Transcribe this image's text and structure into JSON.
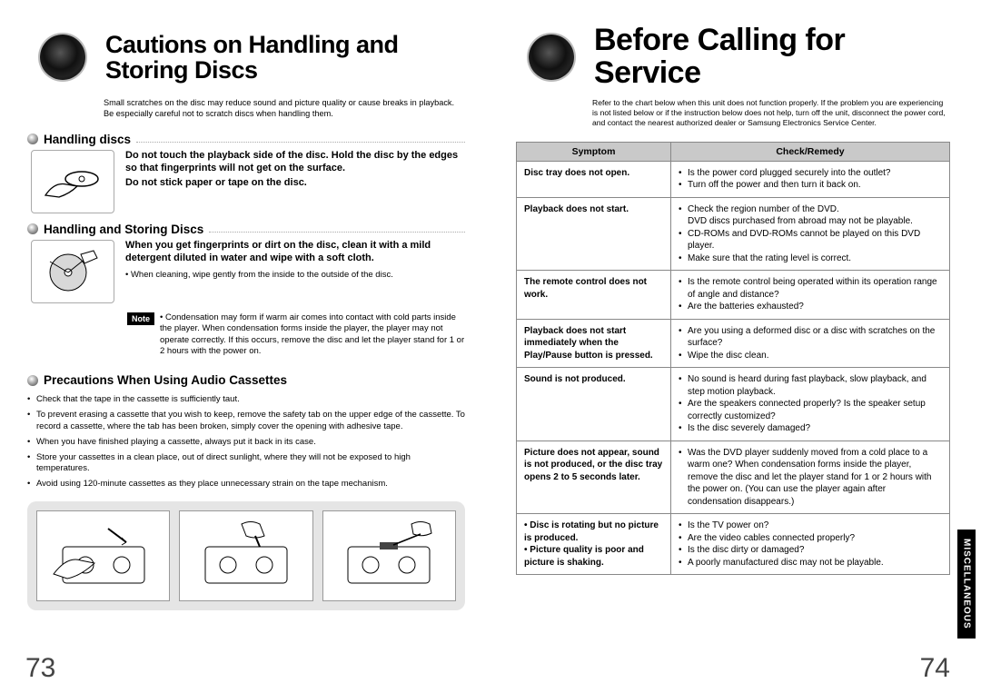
{
  "left": {
    "title": "Cautions on Handling and Storing Discs",
    "intro": "Small scratches on the disc may reduce sound and picture quality or cause breaks in playback. Be especially careful not to scratch discs when handling them.",
    "sec1": {
      "title": "Handling discs",
      "para1": "Do not touch the playback side of the disc. Hold the disc by the edges so that fingerprints will not get on the surface.",
      "para2": "Do not stick paper or tape on the disc."
    },
    "sec2": {
      "title": "Handling and Storing Discs",
      "para": "When you get fingerprints or dirt on the disc, clean it with a mild detergent diluted in water and wipe with a soft cloth.",
      "sub": "When cleaning, wipe gently from the inside to the outside of the disc.",
      "noteLabel": "Note",
      "note": "Condensation may form if warm air comes into contact with cold parts inside the player. When condensation forms inside the player, the player may not operate correctly. If this occurs, remove the disc and let the player stand for 1 or 2 hours with the power on."
    },
    "sec3": {
      "title": "Precautions When Using Audio Cassettes",
      "items": [
        "Check that the tape in the cassette is sufficiently taut.",
        "To prevent erasing a cassette that you wish to keep, remove the safety tab on the upper edge of the cassette. To record a cassette, where  the tab has been broken, simply cover the opening with adhesive tape.",
        "When you have finished playing a cassette, always put it back in its case.",
        "Store your cassettes in a clean place, out of direct sunlight, where they will not be exposed to high temperatures.",
        "Avoid using 120-minute cassettes as they place unnecessary strain on the tape mechanism."
      ]
    },
    "pageNum": "73"
  },
  "right": {
    "title": "Before Calling for Service",
    "intro": "Refer to the chart below when this unit does not function properly. If the problem you are experiencing is not listed below or if the instruction below does not help, turn off the unit, disconnect the power cord, and contact the nearest authorized dealer or Samsung Electronics Service Center.",
    "thSymptom": "Symptom",
    "thRemedy": "Check/Remedy",
    "rows": [
      {
        "symptom": "Disc tray does not open.",
        "remedies": [
          "Is the power cord plugged securely into the outlet?",
          "Turn off the power and then turn it back on."
        ]
      },
      {
        "symptom": "Playback does not start.",
        "remedies": [
          "Check the region number of the DVD.\nDVD discs purchased from abroad may not be playable.",
          "CD-ROMs and DVD-ROMs cannot be played on this DVD player.",
          "Make sure that the rating level is correct."
        ]
      },
      {
        "symptom": "The remote control does not work.",
        "remedies": [
          "Is the remote control being operated within its operation range of angle and distance?",
          "Are the batteries exhausted?"
        ]
      },
      {
        "symptom": "Playback does not start immediately when the Play/Pause button is pressed.",
        "remedies": [
          "Are you using a deformed disc or a disc with scratches on the surface?",
          "Wipe the disc clean."
        ]
      },
      {
        "symptom": "Sound is not produced.",
        "remedies": [
          "No sound is heard during fast playback, slow playback, and step motion playback.",
          "Are the speakers connected properly? Is the speaker setup correctly customized?",
          "Is the disc severely damaged?"
        ]
      },
      {
        "symptom": "Picture does not appear, sound is not produced, or the disc tray opens 2 to 5 seconds later.",
        "remedies": [
          "Was the DVD player suddenly moved from a cold place to a warm one? When condensation forms inside the player, remove the disc and let the player stand for 1 or 2 hours with the power on. (You can use the player again after condensation disappears.)"
        ]
      },
      {
        "symptom": "• Disc is rotating but no picture is produced.\n• Picture quality is poor and picture is shaking.",
        "remedies": [
          "Is the TV power on?",
          "Are the video cables connected properly?",
          "Is the disc dirty or damaged?",
          "A poorly manufactured disc may not be playable."
        ]
      }
    ],
    "sideTab": "MISCELLANEOUS",
    "pageNum": "74"
  }
}
